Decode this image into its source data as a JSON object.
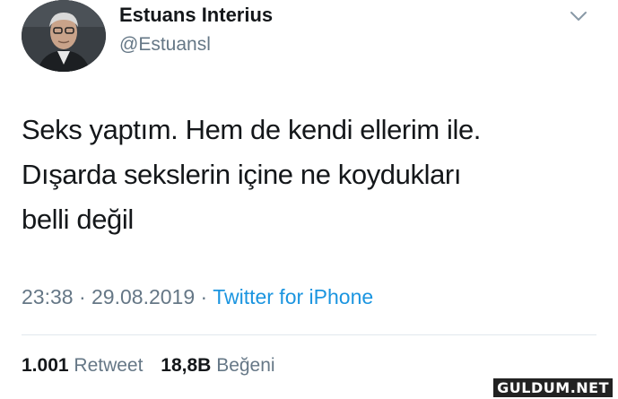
{
  "author": {
    "display_name": "Estuans Interius",
    "handle": "@Estuansl",
    "avatar_icon": "user-avatar-photo"
  },
  "menu": {
    "icon": "chevron-down-icon"
  },
  "tweet": {
    "lines": [
      "Seks yaptım. Hem de kendi ellerim ile.",
      "Dışarda sekslerin içine ne koydukları",
      "belli değil"
    ]
  },
  "meta": {
    "time": "23:38",
    "separator": "·",
    "date": "29.08.2019",
    "source": "Twitter for iPhone"
  },
  "stats": {
    "retweet_count": "1.001",
    "retweet_label": "Retweet",
    "like_count": "18,8B",
    "like_label": "Beğeni"
  },
  "watermark": "GULDUM.NET",
  "colors": {
    "text": "#14171a",
    "muted": "#657786",
    "link": "#1b95e0",
    "divider": "#e1e8ed"
  }
}
